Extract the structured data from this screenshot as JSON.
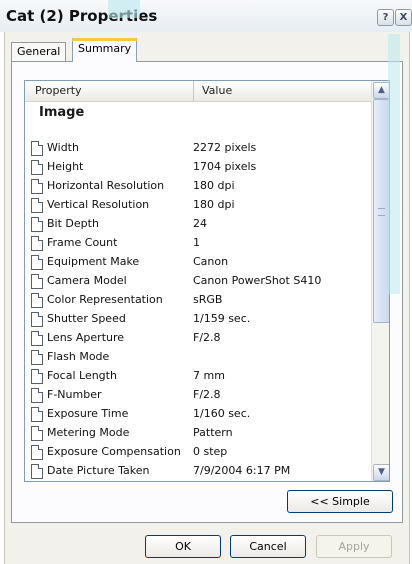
{
  "window": {
    "title": "Cat (2) Properties",
    "help_label": "?",
    "close_label": "X"
  },
  "tabs": [
    {
      "label": "General"
    },
    {
      "label": "Summary"
    }
  ],
  "list": {
    "headers": {
      "property": "Property",
      "value": "Value"
    },
    "group": "Image",
    "rows": [
      {
        "property": "Width",
        "value": "2272 pixels"
      },
      {
        "property": "Height",
        "value": "1704 pixels"
      },
      {
        "property": "Horizontal Resolution",
        "value": "180 dpi"
      },
      {
        "property": "Vertical Resolution",
        "value": "180 dpi"
      },
      {
        "property": "Bit Depth",
        "value": "24"
      },
      {
        "property": "Frame Count",
        "value": "1"
      },
      {
        "property": "Equipment Make",
        "value": "Canon"
      },
      {
        "property": "Camera Model",
        "value": "Canon PowerShot S410"
      },
      {
        "property": "Color Representation",
        "value": "sRGB"
      },
      {
        "property": "Shutter Speed",
        "value": "1/159 sec."
      },
      {
        "property": "Lens Aperture",
        "value": "F/2.8"
      },
      {
        "property": "Flash Mode",
        "value": ""
      },
      {
        "property": "Focal Length",
        "value": "7 mm"
      },
      {
        "property": "F-Number",
        "value": "F/2.8"
      },
      {
        "property": "Exposure Time",
        "value": "1/160 sec."
      },
      {
        "property": "Metering Mode",
        "value": "Pattern"
      },
      {
        "property": "Exposure Compensation",
        "value": "0 step"
      },
      {
        "property": "Date Picture Taken",
        "value": "7/9/2004 6:17 PM"
      }
    ]
  },
  "buttons": {
    "simple": "<< Simple",
    "ok": "OK",
    "cancel": "Cancel",
    "apply": "Apply"
  },
  "colors": {
    "accent_tab": "#ffc73c",
    "glass_streak": "#b9e9ee"
  }
}
